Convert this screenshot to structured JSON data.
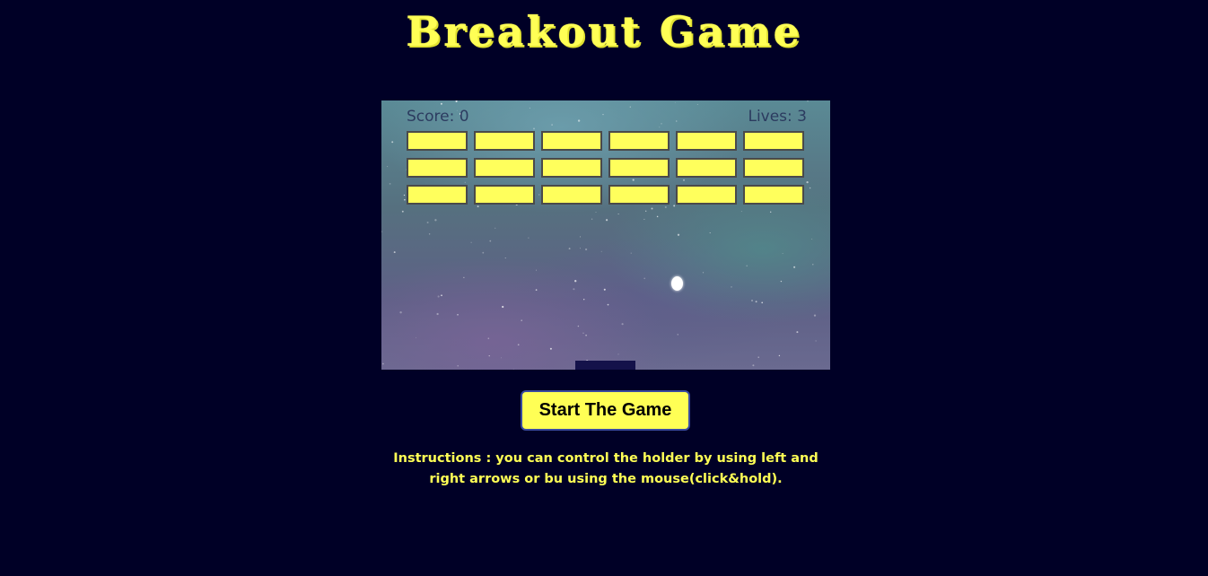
{
  "title": "Breakout Game",
  "hud": {
    "score_text": "Score: 0",
    "lives_text": "Lives: 3"
  },
  "game_state": {
    "score": 0,
    "lives": 3,
    "brick_rows": 3,
    "brick_columns": 6
  },
  "start_button_label": "Start The Game",
  "instructions": "Instructions : you can control the holder by using left and right arrows or bu using the mouse(click&hold).",
  "colors": {
    "background": "#000026",
    "accent_yellow": "#ffff55",
    "paddle": "#14124a",
    "ball": "#ffffff"
  }
}
